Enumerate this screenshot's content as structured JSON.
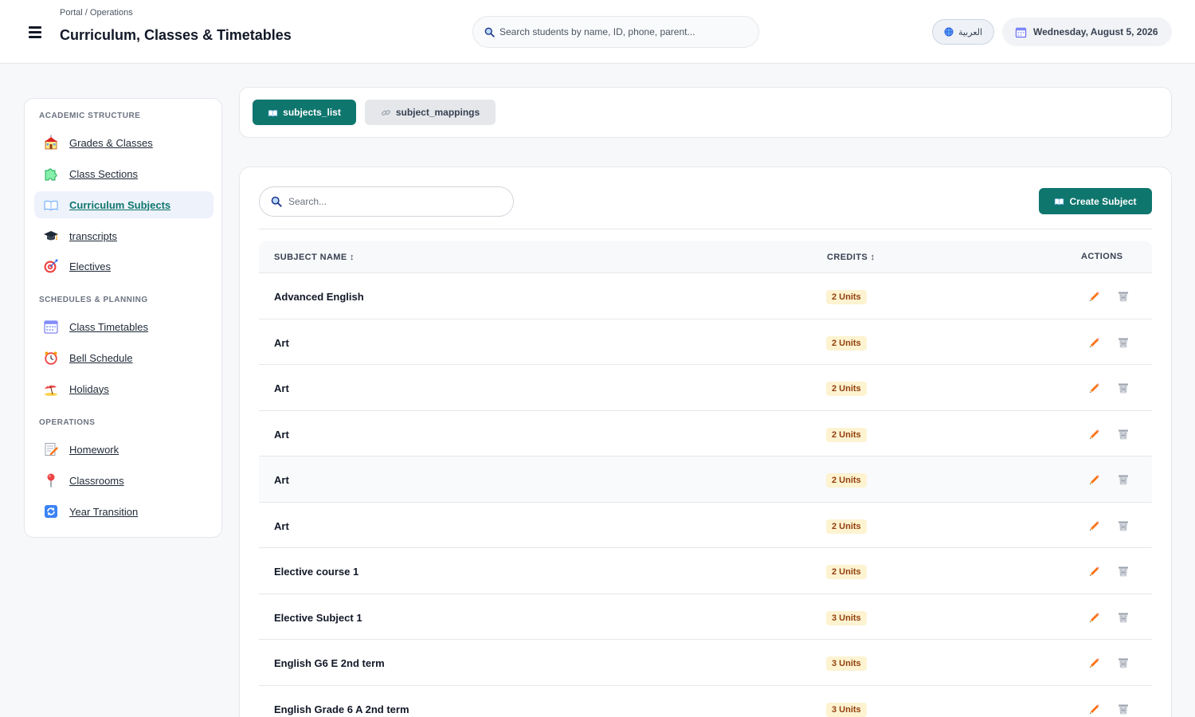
{
  "header": {
    "breadcrumb": "Portal / Operations",
    "title": "Curriculum, Classes & Timetables",
    "search_placeholder": "Search students by name, ID, phone, parent...",
    "language_label": "العربية",
    "date": "Wednesday, August 5, 2026"
  },
  "sidebar": {
    "sections": [
      {
        "label": "ACADEMIC STRUCTURE"
      },
      {
        "label": "SCHEDULES & PLANNING"
      },
      {
        "label": "OPERATIONS"
      }
    ],
    "items": [
      {
        "label": "Grades & Classes",
        "icon": "school-icon"
      },
      {
        "label": "Class Sections",
        "icon": "puzzle-icon"
      },
      {
        "label": "Curriculum Subjects",
        "icon": "book-icon",
        "active": true
      },
      {
        "label": "transcripts",
        "icon": "graduation-cap-icon"
      },
      {
        "label": "Electives",
        "icon": "target-icon"
      },
      {
        "label": "Class Timetables",
        "icon": "calendar-icon"
      },
      {
        "label": "Bell Schedule",
        "icon": "alarm-clock-icon"
      },
      {
        "label": "Holidays",
        "icon": "beach-umbrella-icon"
      },
      {
        "label": "Homework",
        "icon": "memo-icon"
      },
      {
        "label": "Classrooms",
        "icon": "pin-icon"
      },
      {
        "label": "Year Transition",
        "icon": "refresh-icon"
      }
    ]
  },
  "tabs": [
    {
      "label": "subjects_list",
      "icon": "book-icon",
      "active": true
    },
    {
      "label": "subject_mappings",
      "icon": "link-icon",
      "active": false
    }
  ],
  "toolbar": {
    "search_placeholder": "Search...",
    "create_label": "Create Subject"
  },
  "table": {
    "columns": [
      "SUBJECT NAME ↕",
      "CREDITS ↕",
      "ACTIONS"
    ],
    "rows": [
      {
        "name": "Advanced English",
        "credits": "2 Units"
      },
      {
        "name": "Art",
        "credits": "2 Units"
      },
      {
        "name": "Art",
        "credits": "2 Units"
      },
      {
        "name": "Art",
        "credits": "2 Units"
      },
      {
        "name": "Art",
        "credits": "2 Units"
      },
      {
        "name": "Art",
        "credits": "2 Units"
      },
      {
        "name": "Elective course 1",
        "credits": "2 Units"
      },
      {
        "name": "Elective Subject 1",
        "credits": "3 Units"
      },
      {
        "name": "English G6 E 2nd term",
        "credits": "3 Units"
      },
      {
        "name": "English Grade 6 A 2nd term",
        "credits": "3 Units"
      }
    ]
  },
  "colors": {
    "primary": "#0f766e",
    "badge_bg": "#fdf3d1",
    "badge_text": "#92400e",
    "edit_icon": "#ea580c"
  }
}
